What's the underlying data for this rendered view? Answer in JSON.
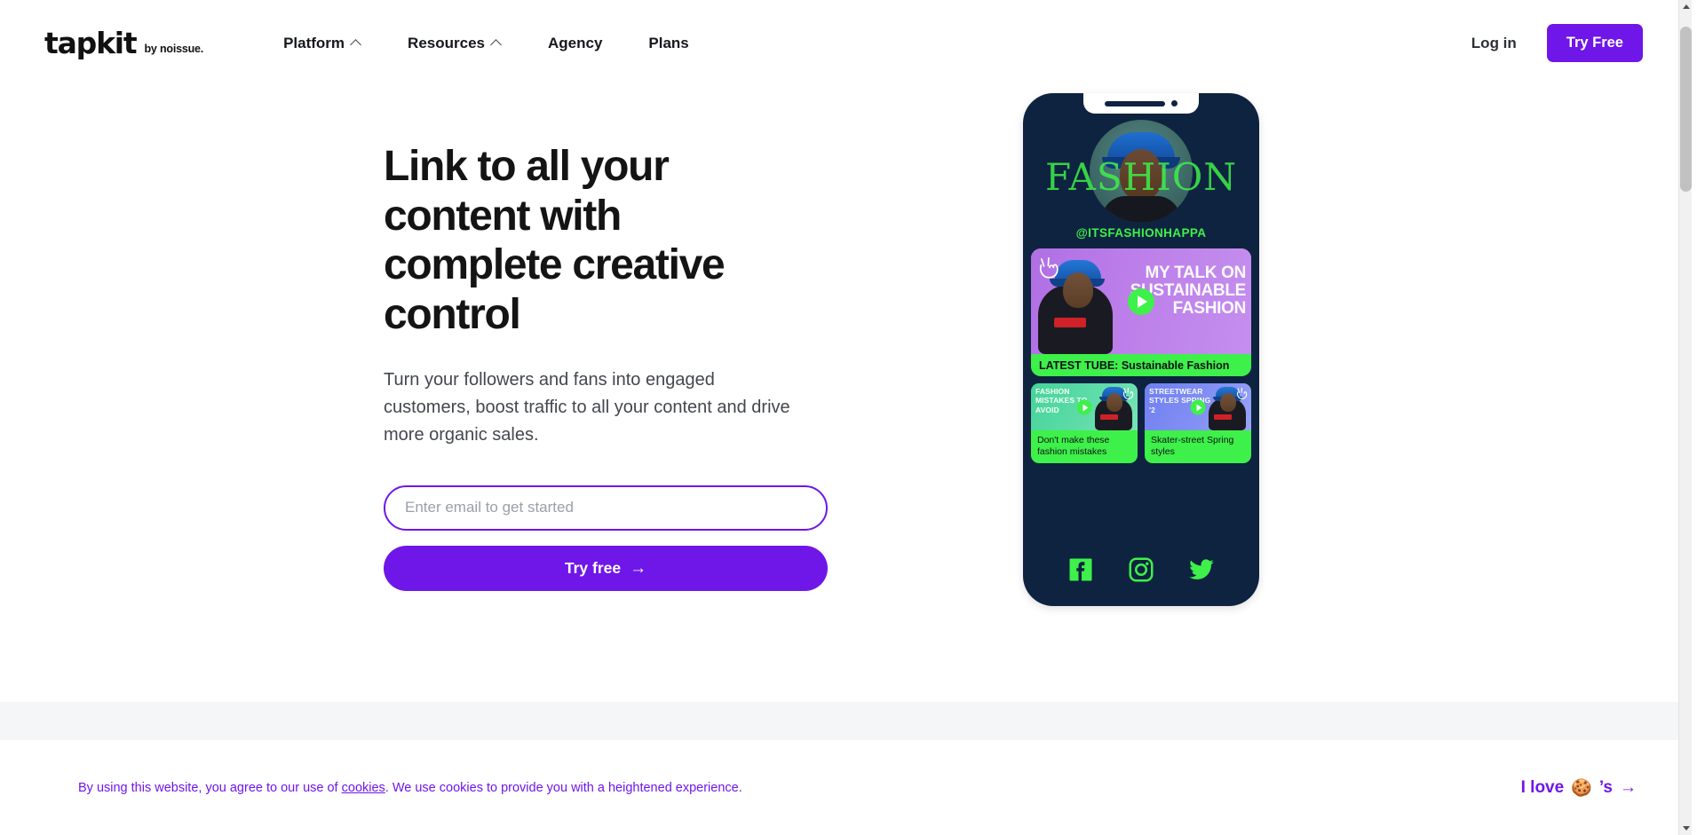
{
  "header": {
    "logo_word": "tapkit",
    "logo_sub": "by noissue.",
    "nav": [
      {
        "label": "Platform",
        "has_caret": true,
        "caret_icon": "chevron-up-icon"
      },
      {
        "label": "Resources",
        "has_caret": true,
        "caret_icon": "chevron-up-icon"
      },
      {
        "label": "Agency",
        "has_caret": false
      },
      {
        "label": "Plans",
        "has_caret": false
      }
    ],
    "login_label": "Log in",
    "try_free_label": "Try Free"
  },
  "hero": {
    "title": "Link to all your content with complete creative control",
    "subtitle": "Turn your followers and fans into engaged customers, boost traffic to all your content and drive more organic sales.",
    "email_placeholder": "Enter email to get started",
    "email_value": "",
    "cta_label": "Try free",
    "cta_arrow": "→"
  },
  "phone": {
    "overlay_title": "FASHION",
    "handle": "@ITSFASHIONHAPPA",
    "main_card": {
      "headline": "MY TALK ON SUSTAINABLE FASHION",
      "label": "LATEST TUBE: Sustainable Fashion",
      "play_icon": "play-icon",
      "hand_icon": "peace-hand-icon"
    },
    "small_cards": [
      {
        "thumb_text": "FASHION MISTAKES TO AVOID",
        "caption": "Don't make these fashion mistakes",
        "play_icon": "play-icon",
        "hand_icon": "peace-hand-icon"
      },
      {
        "thumb_text": "STREETWEAR STYLES SPRING '2",
        "caption": "Skater-street Spring styles",
        "play_icon": "play-icon",
        "hand_icon": "peace-hand-icon"
      }
    ],
    "socials": [
      {
        "name": "facebook-icon"
      },
      {
        "name": "instagram-icon"
      },
      {
        "name": "twitter-icon"
      }
    ]
  },
  "cookie_bar": {
    "text_before": "By using this website, you agree to our use of ",
    "link_label": "cookies",
    "text_after": ". We use cookies to provide you with a heightened experience.",
    "accept_prefix": "I love",
    "accept_emoji": "🍪",
    "accept_suffix": "’s",
    "accept_arrow": "→"
  },
  "colors": {
    "brand_purple": "#6F16E8",
    "accent_green": "#3EF04A",
    "phone_navy": "#0E2340",
    "card_purple": "#B474E8",
    "band_gray": "#F4F6F8"
  }
}
